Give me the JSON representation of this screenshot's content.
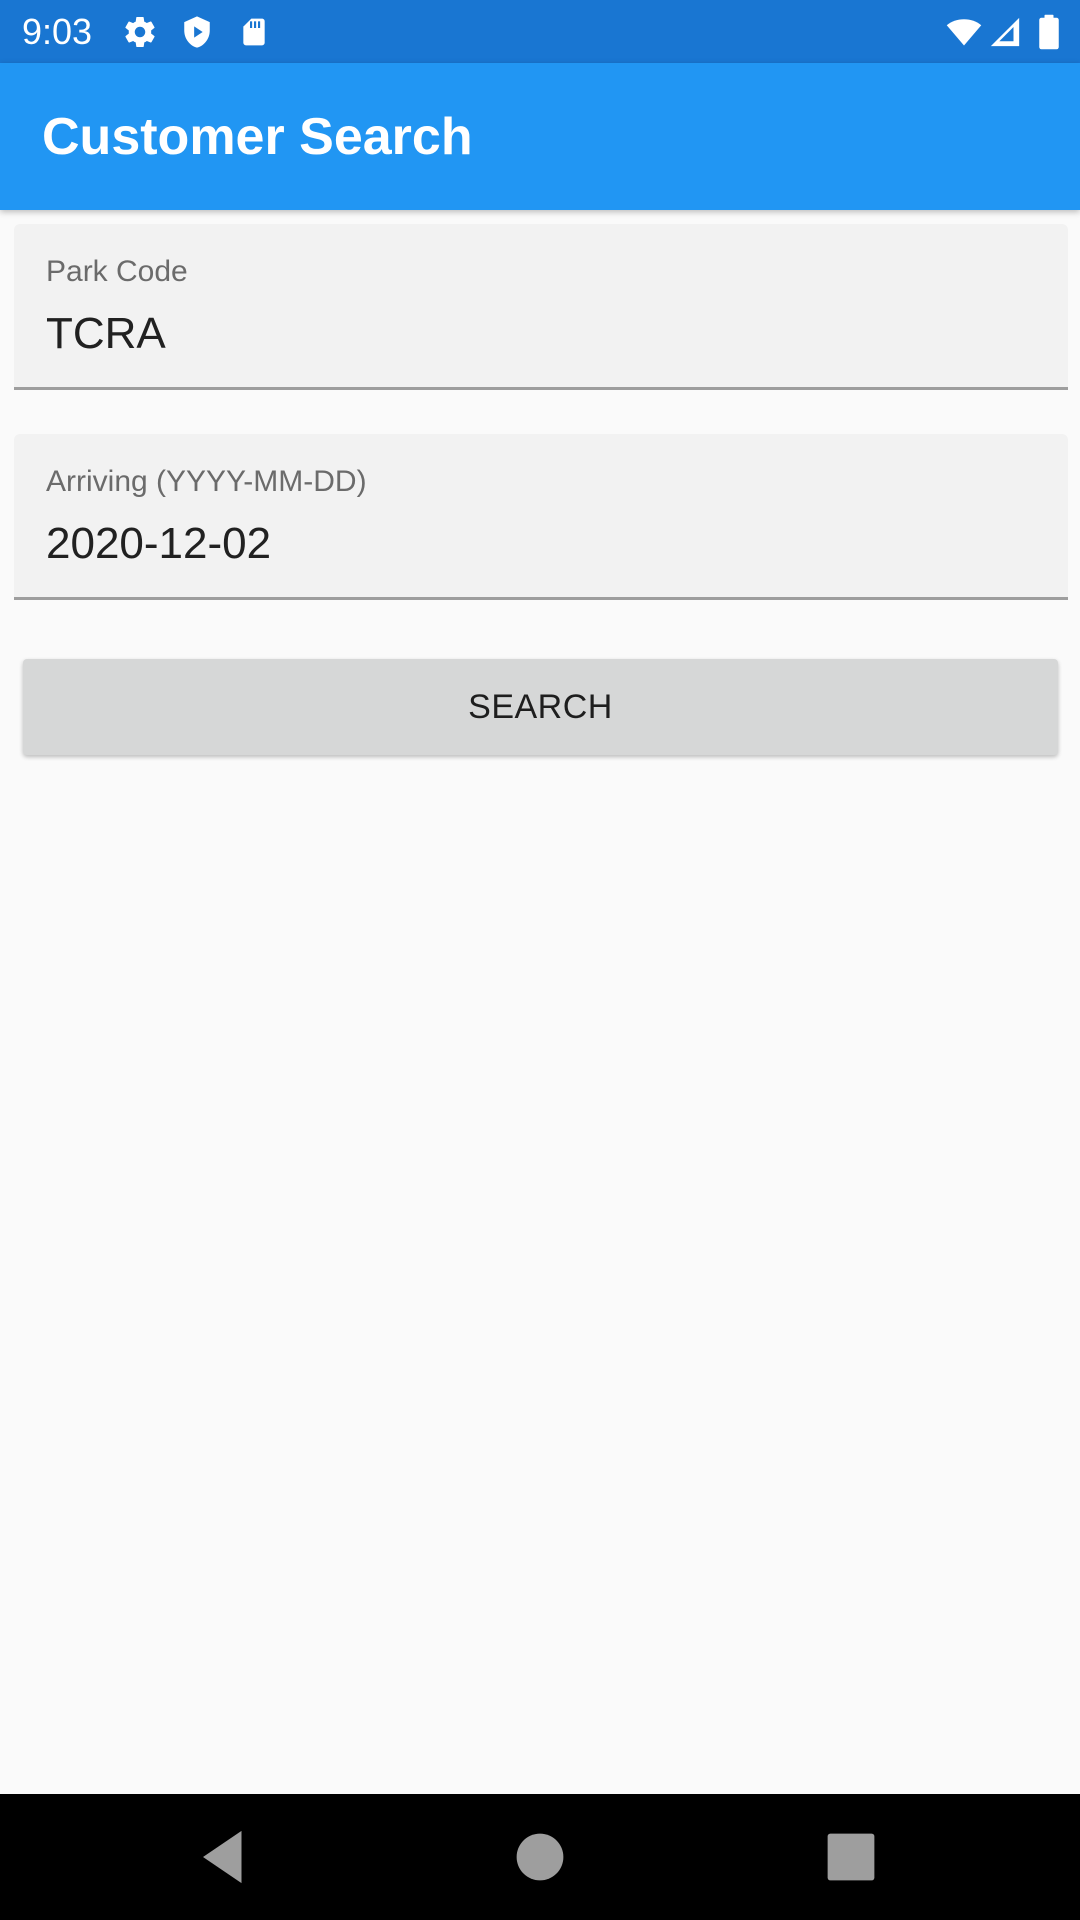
{
  "status_bar": {
    "time": "9:03",
    "icons_left": [
      "settings-icon",
      "play-protect-icon",
      "sd-card-icon"
    ],
    "icons_right": [
      "wifi-icon",
      "cell-signal-icon",
      "battery-icon"
    ]
  },
  "app_bar": {
    "title": "Customer Search",
    "color": "#2196f3"
  },
  "form": {
    "park_code": {
      "label": "Park Code",
      "value": "TCRA"
    },
    "arriving": {
      "label": "Arriving (YYYY-MM-DD)",
      "value": "2020-12-02"
    },
    "search_label": "SEARCH"
  },
  "nav_bar": {
    "buttons": [
      "back-icon",
      "home-icon",
      "recents-icon"
    ]
  }
}
